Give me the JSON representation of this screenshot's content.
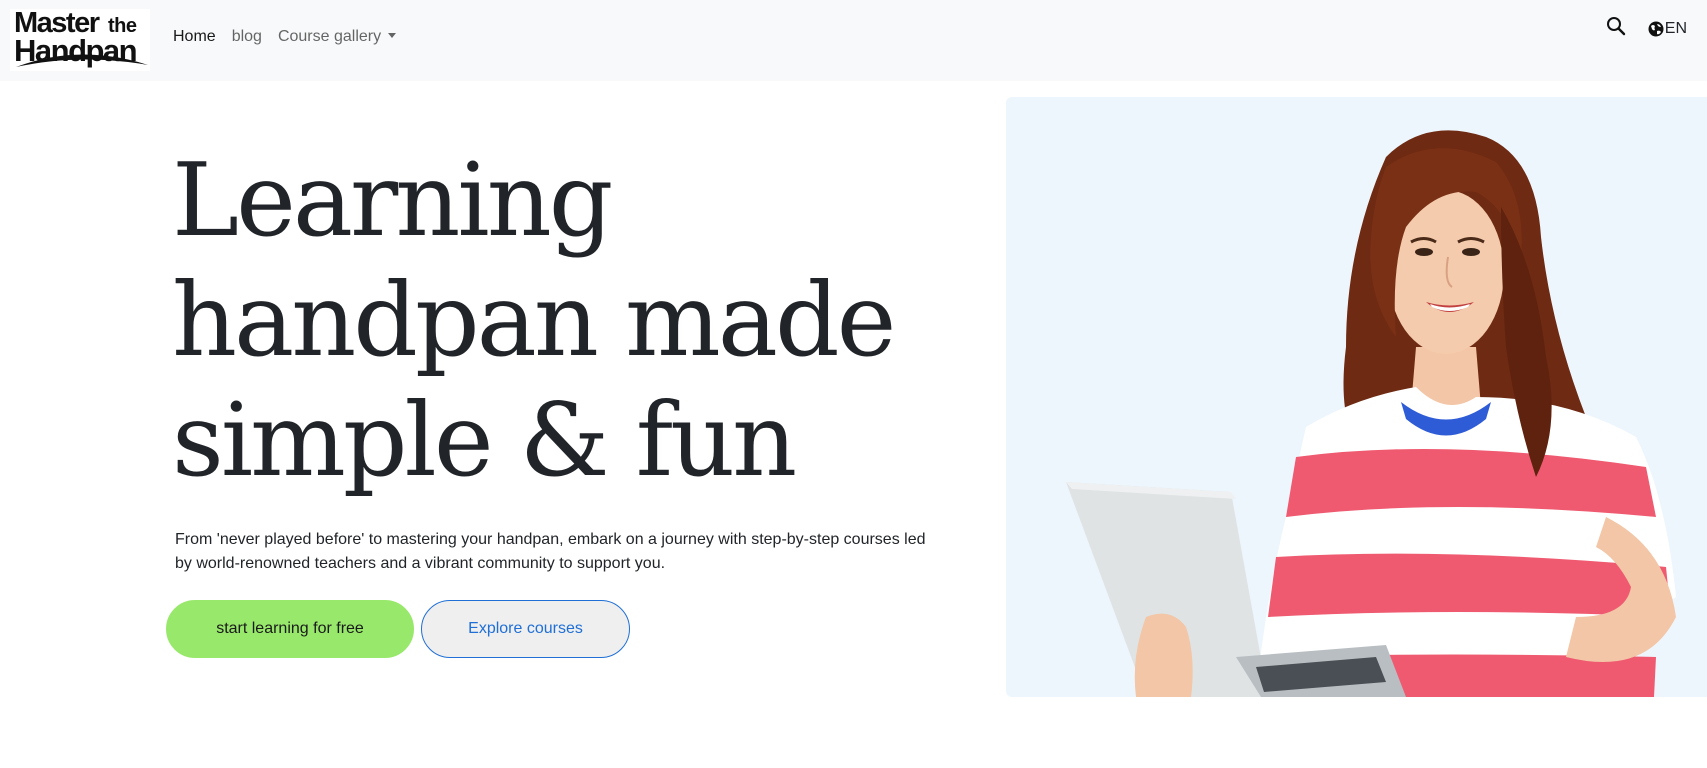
{
  "navbar": {
    "logo": {
      "line1": "Master",
      "line2": "the",
      "line3": "Handpan"
    },
    "links": [
      {
        "label": "Home",
        "active": true
      },
      {
        "label": "blog",
        "active": false
      },
      {
        "label": "Course gallery",
        "active": false,
        "dropdown": true
      }
    ],
    "search_icon": "search-icon",
    "language": {
      "icon": "globe-icon",
      "label": "EN"
    }
  },
  "hero": {
    "title_lines": [
      "Learning",
      "handpan made",
      "simple & fun"
    ],
    "subtitle": "From 'never played before' to mastering your handpan, embark on a journey with step-by-step courses led by world-renowned teachers and a vibrant community to support you.",
    "primary_button": "start learning for free",
    "secondary_button": "Explore courses"
  },
  "colors": {
    "navbar_bg": "#f8f9fa",
    "primary_button": "#98e96b",
    "secondary_border": "#1f6fd6",
    "hero_image_bg": "#eef6fd",
    "shirt_pink": "#ef5a70"
  }
}
